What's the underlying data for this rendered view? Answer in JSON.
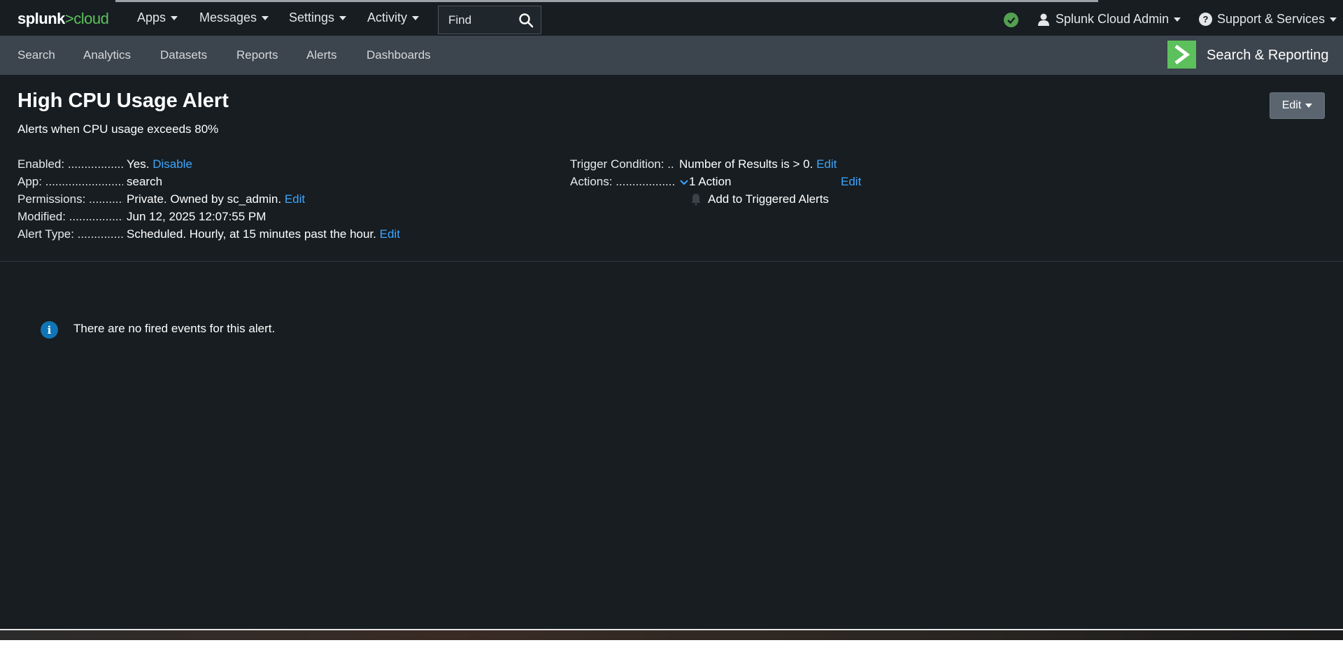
{
  "topbar": {
    "logo": {
      "left": "splunk",
      "sep": ">",
      "right": "cloud"
    },
    "menus": [
      "Apps",
      "Messages",
      "Settings",
      "Activity"
    ],
    "find_placeholder": "Find",
    "user": "Splunk Cloud Admin",
    "support": "Support & Services",
    "status_color": "#53a051"
  },
  "appnav": {
    "items": [
      "Search",
      "Analytics",
      "Datasets",
      "Reports",
      "Alerts",
      "Dashboards"
    ],
    "app_title": "Search & Reporting",
    "app_icon_color": "#5cc05c"
  },
  "alert": {
    "title": "High CPU Usage Alert",
    "description": "Alerts when CPU usage exceeds 80%",
    "edit_label": "Edit",
    "left": {
      "enabled": {
        "label": "Enabled: .....................",
        "value": "Yes.",
        "link": "Disable"
      },
      "app": {
        "label": "App: ..............................",
        "value": "search"
      },
      "permissions": {
        "label": "Permissions: ............",
        "value": "Private. Owned by sc_admin.",
        "link": "Edit"
      },
      "modified": {
        "label": "Modified: ....................",
        "value": "Jun 12, 2025 12:07:55 PM"
      },
      "alert_type": {
        "label": "Alert Type: ................",
        "value": "Scheduled. Hourly, at 15 minutes past the hour.",
        "link": "Edit"
      }
    },
    "right": {
      "trigger": {
        "label": "Trigger Condition: ..",
        "value": "Number of Results is > 0.",
        "link": "Edit"
      },
      "actions": {
        "label": "Actions: .....................",
        "value": "1 Action",
        "link": "Edit",
        "item": "Add to Triggered Alerts"
      }
    }
  },
  "events": {
    "message": "There are no fired events for this alert."
  }
}
